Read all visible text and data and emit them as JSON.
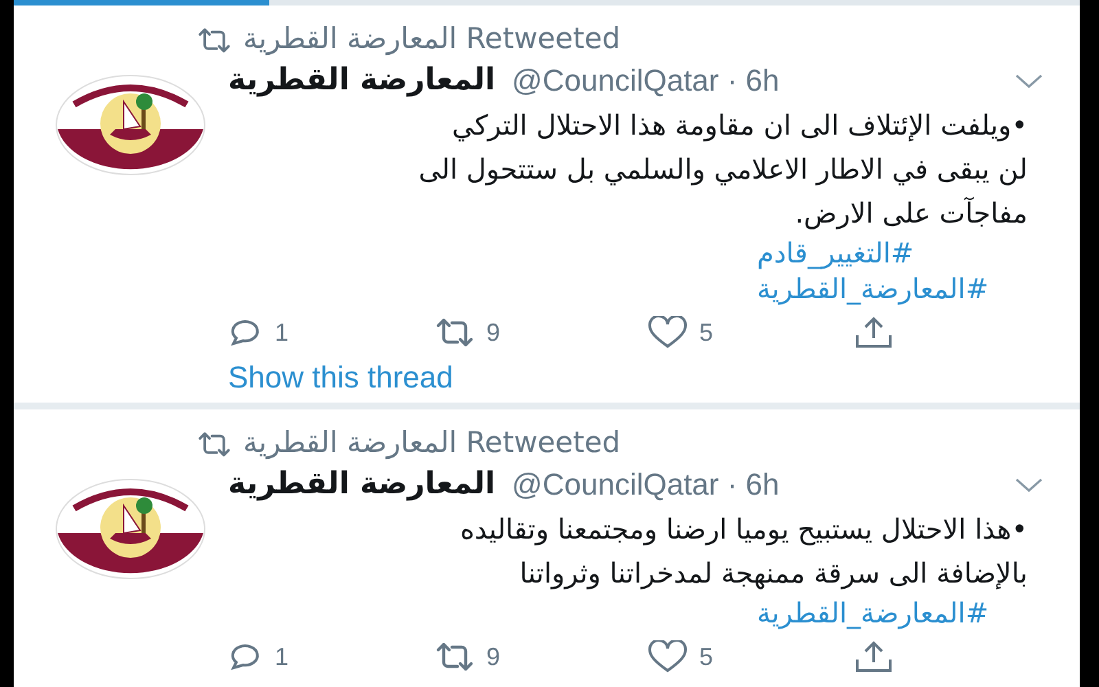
{
  "progress": {
    "level": 0.24
  },
  "tweets": [
    {
      "retweeted_by": "المعارضة القطرية Retweeted",
      "name": "المعارضة القطرية",
      "handle": "@CouncilQatar · 6h",
      "text": "•ويلفت الإئتلاف الى ان مقاومة  هذا الاحتلال التركي\nلن يبقى في الاطار الاعلامي والسلمي بل ستتحول الى\nمفاجآت على الارض.",
      "hashtags": [
        "#التغيير_قادم",
        "#المعارضة_القطرية"
      ],
      "replies": "1",
      "retweets": "9",
      "likes": "5",
      "thread_link": "Show this thread"
    },
    {
      "retweeted_by": "المعارضة القطرية Retweeted",
      "name": "المعارضة القطرية",
      "handle": "@CouncilQatar · 6h",
      "text": "•هذا الاحتلال  يستبيح يوميا ارضنا ومجتمعنا وتقاليده\nبالإضافة الى سرقة ممنهجة لمدخراتنا وثرواتنا",
      "hashtags": [
        "#المعارضة_القطرية"
      ],
      "replies": "1",
      "retweets": "9",
      "likes": "5"
    }
  ]
}
